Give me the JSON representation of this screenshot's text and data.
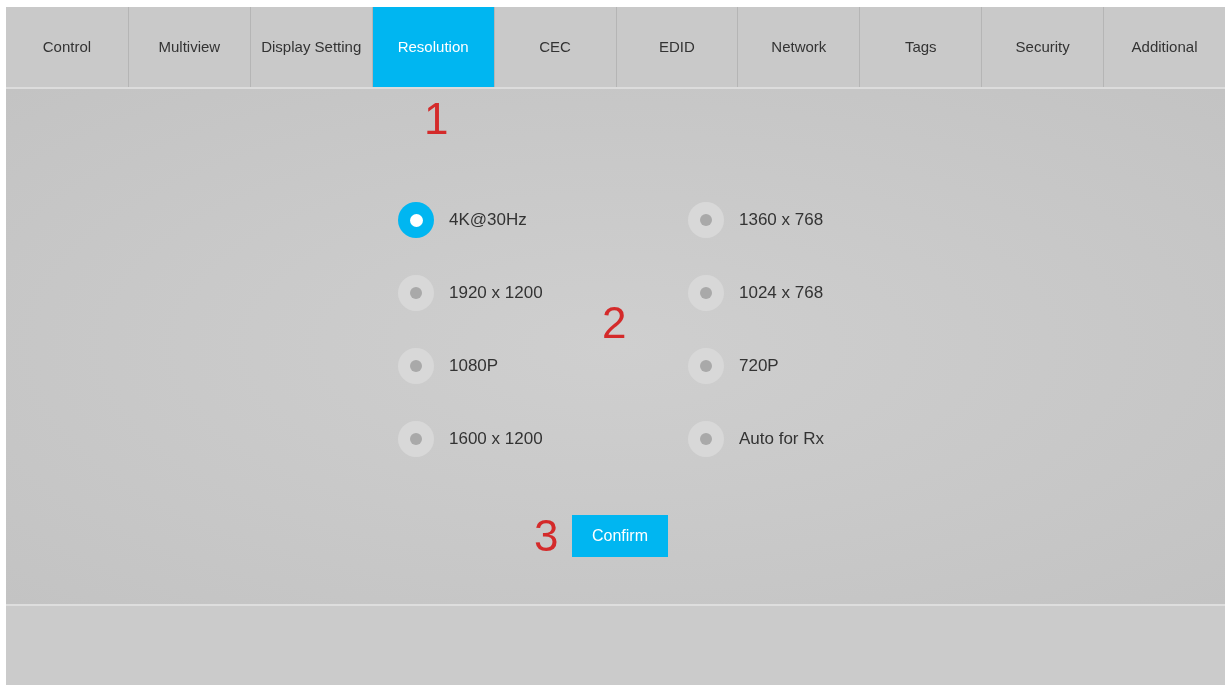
{
  "tabs": [
    {
      "label": "Control",
      "selected": false
    },
    {
      "label": "Multiview",
      "selected": false
    },
    {
      "label": "Display Setting",
      "selected": false
    },
    {
      "label": "Resolution",
      "selected": true
    },
    {
      "label": "CEC",
      "selected": false
    },
    {
      "label": "EDID",
      "selected": false
    },
    {
      "label": "Network",
      "selected": false
    },
    {
      "label": "Tags",
      "selected": false
    },
    {
      "label": "Security",
      "selected": false
    },
    {
      "label": "Additional",
      "selected": false
    }
  ],
  "resolutions": [
    {
      "label": "4K@30Hz",
      "selected": true
    },
    {
      "label": "1360 x 768",
      "selected": false
    },
    {
      "label": "1920 x 1200",
      "selected": false
    },
    {
      "label": "1024 x 768",
      "selected": false
    },
    {
      "label": "1080P",
      "selected": false
    },
    {
      "label": "720P",
      "selected": false
    },
    {
      "label": "1600 x 1200",
      "selected": false
    },
    {
      "label": "Auto for Rx",
      "selected": false
    }
  ],
  "confirm_button": "Confirm",
  "annotations": [
    "1",
    "2",
    "3"
  ]
}
